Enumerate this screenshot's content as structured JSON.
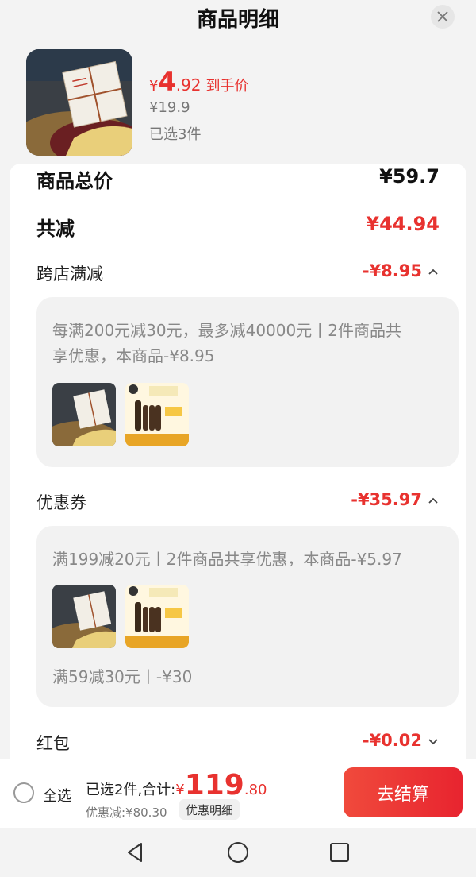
{
  "header": {
    "title": "商品明细"
  },
  "product": {
    "price_yen": "¥",
    "price_int": "4",
    "price_dec": ".92",
    "price_suffix": "到手价",
    "original_price": "¥19.9",
    "selected_qty": "已选3件"
  },
  "summary": {
    "total_label": "商品总价",
    "total_value": "¥59.7",
    "reduce_label": "共减",
    "reduce_value": "¥44.94"
  },
  "cross_store": {
    "label": "跨店满减",
    "value": "-¥8.95",
    "detail_line1": "每满200元减30元，最多减40000元丨2件商品共",
    "detail_line2": "享优惠，本商品-¥8.95"
  },
  "coupon": {
    "label": "优惠券",
    "value": "-¥35.97",
    "detail1": "满199减20元丨2件商品共享优惠，本商品-¥5.97",
    "detail2": "满59减30元丨-¥30"
  },
  "red_packet": {
    "label": "红包",
    "value": "-¥0.02"
  },
  "bottom": {
    "select_all": "全选",
    "selected_text": "已选2件,合计:",
    "total_yen": "¥",
    "total_int": "119",
    "total_dec": ".80",
    "discount_text": "优惠减:¥80.30",
    "detail_button": "优惠明细",
    "checkout_button": "去结算"
  },
  "colors": {
    "accent_red": "#e8322f",
    "panel_bg": "#ffffff",
    "page_bg": "#f3f3f3"
  },
  "icons": [
    "close-icon",
    "chevron-up-icon",
    "chevron-down-icon",
    "nav-back-icon",
    "nav-home-icon",
    "nav-recents-icon"
  ]
}
